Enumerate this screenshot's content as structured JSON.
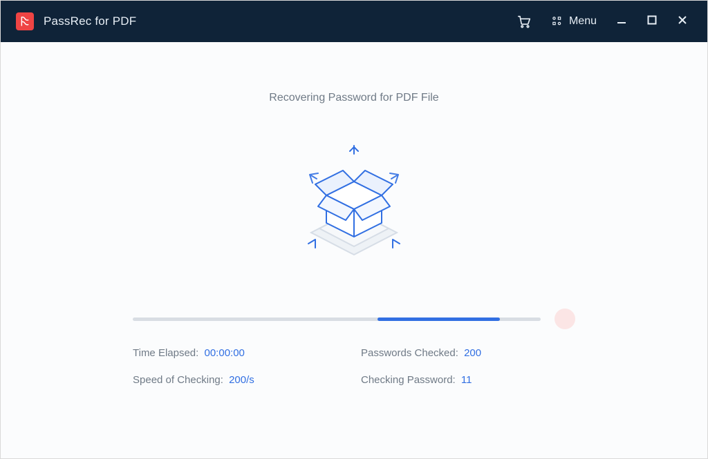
{
  "app": {
    "title": "PassRec for PDF",
    "menu_label": "Menu"
  },
  "main": {
    "heading": "Recovering Password for PDF File"
  },
  "progress": {
    "indeterminate_segment": {
      "left_percent": 60,
      "width_percent": 30
    }
  },
  "stats": {
    "time_elapsed_label": "Time Elapsed:",
    "time_elapsed_value": "00:00:00",
    "passwords_checked_label": "Passwords Checked:",
    "passwords_checked_value": "200",
    "speed_label": "Speed of Checking:",
    "speed_value": "200/s",
    "checking_password_label": "Checking Password:",
    "checking_password_value": "11"
  },
  "colors": {
    "titlebar_bg": "#0f2338",
    "accent": "#316fe2",
    "app_icon_bg": "#ef4444",
    "stop_bg": "#fbe5e5",
    "stop_square": "#e74a3b",
    "text_muted": "#6f7a86"
  },
  "icons": {
    "app": "pdf-app-icon",
    "cart": "cart-icon",
    "menu_grid": "menu-grid-icon",
    "minimize": "minimize-icon",
    "maximize": "maximize-icon",
    "close": "close-icon",
    "box_graphic": "open-box-icon",
    "stop": "stop-icon"
  }
}
